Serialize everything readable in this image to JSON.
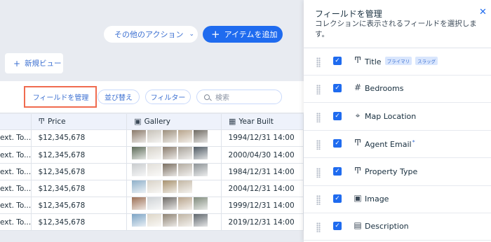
{
  "header": {
    "more_actions_label": "その他のアクション",
    "add_item_label": "アイテムを追加",
    "new_view_label": "新規ビュー"
  },
  "toolbar": {
    "manage_fields_label": "フィールドを管理",
    "sort_label": "並び替え",
    "filter_label": "フィルター",
    "search_placeholder": "検索"
  },
  "table": {
    "columns": [
      {
        "label": "",
        "icon": "text-icon"
      },
      {
        "label": "Price",
        "icon": "text-icon"
      },
      {
        "label": "Gallery",
        "icon": "image-icon"
      },
      {
        "label": "Year Built",
        "icon": "calendar-icon"
      }
    ],
    "rows": [
      {
        "c0": "ext. To...",
        "price": "$12,345,678",
        "year": "1994/12/31 14:00"
      },
      {
        "c0": "ext. To...",
        "price": "$12,345,678",
        "year": "2000/04/30 14:00"
      },
      {
        "c0": "ext. To...",
        "price": "$12,345,678",
        "year": "1984/12/31 14:00"
      },
      {
        "c0": "ext. To...",
        "price": "$12,345,678",
        "year": "2004/12/31 14:00"
      },
      {
        "c0": "ext. To...",
        "price": "$12,345,678",
        "year": "1999/12/31 14:00"
      },
      {
        "c0": "ext. To...",
        "price": "$12,345,678",
        "year": "2019/12/31 14:00"
      }
    ]
  },
  "panel": {
    "title": "フィールドを管理",
    "subtitle": "コレクションに表示されるフィールドを選択します。",
    "fields": [
      {
        "name": "Title",
        "icon": "text-icon",
        "badges": [
          "プライマリ",
          "スラッグ"
        ],
        "required": false
      },
      {
        "name": "Bedrooms",
        "icon": "number-icon",
        "badges": [],
        "required": false
      },
      {
        "name": "Map Location",
        "icon": "location-pin-icon",
        "badges": [],
        "required": false
      },
      {
        "name": "Agent Email",
        "icon": "text-icon",
        "badges": [],
        "required": true
      },
      {
        "name": "Property Type",
        "icon": "text-icon",
        "badges": [],
        "required": false
      },
      {
        "name": "Image",
        "icon": "image-icon",
        "badges": [],
        "required": false
      },
      {
        "name": "Description",
        "icon": "document-icon",
        "badges": [],
        "required": false
      }
    ]
  },
  "colors": {
    "accent": "#1f6bef",
    "highlight": "#f06b4f"
  }
}
